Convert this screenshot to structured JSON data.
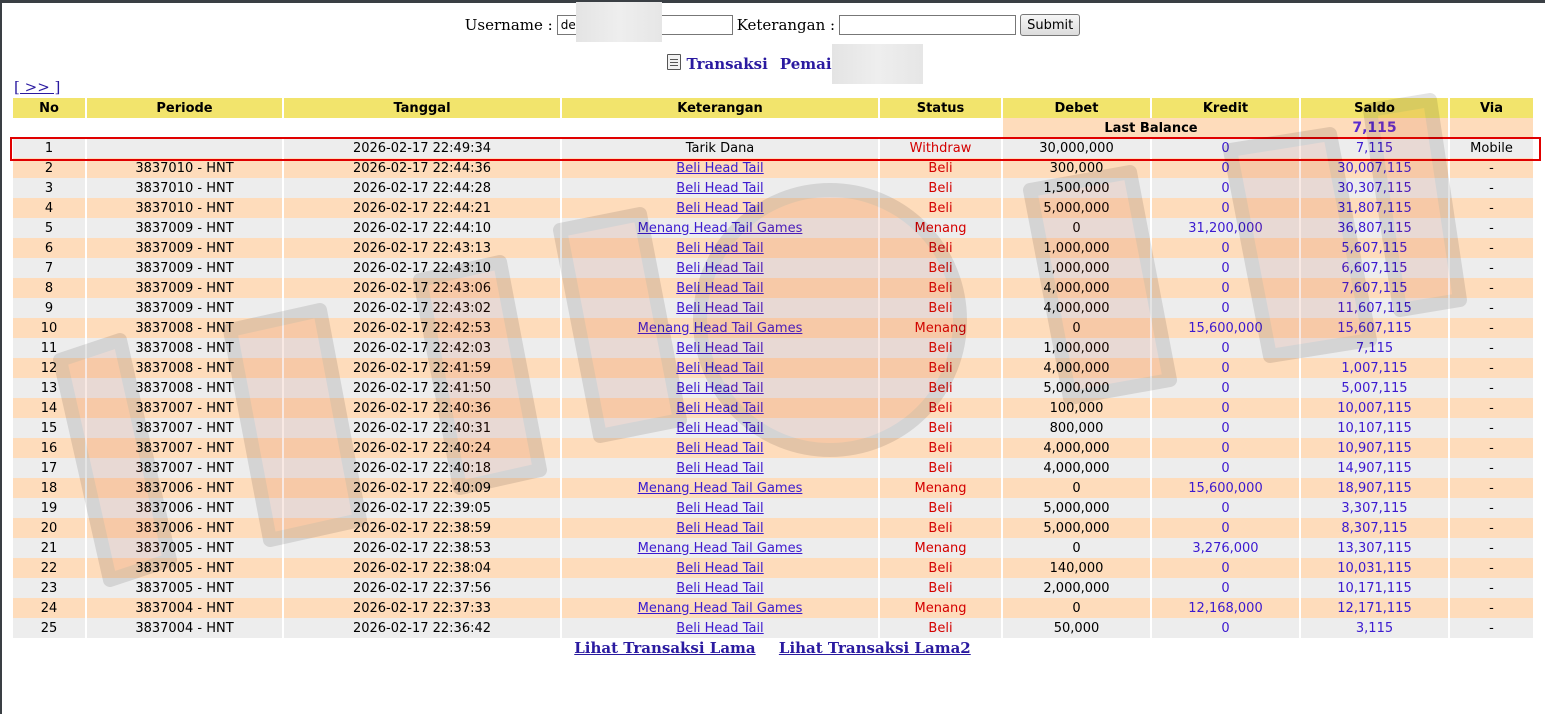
{
  "form": {
    "username_label": "Username :",
    "username_value": "de",
    "keterangan_label": "Keterangan :",
    "keterangan_value": "",
    "submit_label": "Submit"
  },
  "heading": {
    "title": "Transaksi",
    "player_label": "Pemain : de"
  },
  "nav": {
    "next_label": "[ >> ]"
  },
  "table": {
    "columns": [
      "No",
      "Periode",
      "Tanggal",
      "Keterangan",
      "Status",
      "Debet",
      "Kredit",
      "Saldo",
      "Via"
    ],
    "last_balance_label": "Last Balance",
    "last_balance_value": "7,115",
    "rows": [
      {
        "no": "1",
        "periode": "",
        "tanggal": "2026-02-17 22:49:34",
        "keterangan": "Tarik Dana",
        "status": "Withdraw",
        "debet": "30,000,000",
        "kredit": "0",
        "saldo": "7,115",
        "via": "Mobile"
      },
      {
        "no": "2",
        "periode": "3837010 - HNT",
        "tanggal": "2026-02-17 22:44:36",
        "keterangan": "Beli Head Tail",
        "status": "Beli",
        "debet": "300,000",
        "kredit": "0",
        "saldo": "30,007,115",
        "via": "-"
      },
      {
        "no": "3",
        "periode": "3837010 - HNT",
        "tanggal": "2026-02-17 22:44:28",
        "keterangan": "Beli Head Tail",
        "status": "Beli",
        "debet": "1,500,000",
        "kredit": "0",
        "saldo": "30,307,115",
        "via": "-"
      },
      {
        "no": "4",
        "periode": "3837010 - HNT",
        "tanggal": "2026-02-17 22:44:21",
        "keterangan": "Beli Head Tail",
        "status": "Beli",
        "debet": "5,000,000",
        "kredit": "0",
        "saldo": "31,807,115",
        "via": "-"
      },
      {
        "no": "5",
        "periode": "3837009 - HNT",
        "tanggal": "2026-02-17 22:44:10",
        "keterangan": "Menang Head Tail Games",
        "status": "Menang",
        "debet": "0",
        "kredit": "31,200,000",
        "saldo": "36,807,115",
        "via": "-"
      },
      {
        "no": "6",
        "periode": "3837009 - HNT",
        "tanggal": "2026-02-17 22:43:13",
        "keterangan": "Beli Head Tail",
        "status": "Beli",
        "debet": "1,000,000",
        "kredit": "0",
        "saldo": "5,607,115",
        "via": "-"
      },
      {
        "no": "7",
        "periode": "3837009 - HNT",
        "tanggal": "2026-02-17 22:43:10",
        "keterangan": "Beli Head Tail",
        "status": "Beli",
        "debet": "1,000,000",
        "kredit": "0",
        "saldo": "6,607,115",
        "via": "-"
      },
      {
        "no": "8",
        "periode": "3837009 - HNT",
        "tanggal": "2026-02-17 22:43:06",
        "keterangan": "Beli Head Tail",
        "status": "Beli",
        "debet": "4,000,000",
        "kredit": "0",
        "saldo": "7,607,115",
        "via": "-"
      },
      {
        "no": "9",
        "periode": "3837009 - HNT",
        "tanggal": "2026-02-17 22:43:02",
        "keterangan": "Beli Head Tail",
        "status": "Beli",
        "debet": "4,000,000",
        "kredit": "0",
        "saldo": "11,607,115",
        "via": "-"
      },
      {
        "no": "10",
        "periode": "3837008 - HNT",
        "tanggal": "2026-02-17 22:42:53",
        "keterangan": "Menang Head Tail Games",
        "status": "Menang",
        "debet": "0",
        "kredit": "15,600,000",
        "saldo": "15,607,115",
        "via": "-"
      },
      {
        "no": "11",
        "periode": "3837008 - HNT",
        "tanggal": "2026-02-17 22:42:03",
        "keterangan": "Beli Head Tail",
        "status": "Beli",
        "debet": "1,000,000",
        "kredit": "0",
        "saldo": "7,115",
        "via": "-"
      },
      {
        "no": "12",
        "periode": "3837008 - HNT",
        "tanggal": "2026-02-17 22:41:59",
        "keterangan": "Beli Head Tail",
        "status": "Beli",
        "debet": "4,000,000",
        "kredit": "0",
        "saldo": "1,007,115",
        "via": "-"
      },
      {
        "no": "13",
        "periode": "3837008 - HNT",
        "tanggal": "2026-02-17 22:41:50",
        "keterangan": "Beli Head Tail",
        "status": "Beli",
        "debet": "5,000,000",
        "kredit": "0",
        "saldo": "5,007,115",
        "via": "-"
      },
      {
        "no": "14",
        "periode": "3837007 - HNT",
        "tanggal": "2026-02-17 22:40:36",
        "keterangan": "Beli Head Tail",
        "status": "Beli",
        "debet": "100,000",
        "kredit": "0",
        "saldo": "10,007,115",
        "via": "-"
      },
      {
        "no": "15",
        "periode": "3837007 - HNT",
        "tanggal": "2026-02-17 22:40:31",
        "keterangan": "Beli Head Tail",
        "status": "Beli",
        "debet": "800,000",
        "kredit": "0",
        "saldo": "10,107,115",
        "via": "-"
      },
      {
        "no": "16",
        "periode": "3837007 - HNT",
        "tanggal": "2026-02-17 22:40:24",
        "keterangan": "Beli Head Tail",
        "status": "Beli",
        "debet": "4,000,000",
        "kredit": "0",
        "saldo": "10,907,115",
        "via": "-"
      },
      {
        "no": "17",
        "periode": "3837007 - HNT",
        "tanggal": "2026-02-17 22:40:18",
        "keterangan": "Beli Head Tail",
        "status": "Beli",
        "debet": "4,000,000",
        "kredit": "0",
        "saldo": "14,907,115",
        "via": "-"
      },
      {
        "no": "18",
        "periode": "3837006 - HNT",
        "tanggal": "2026-02-17 22:40:09",
        "keterangan": "Menang Head Tail Games",
        "status": "Menang",
        "debet": "0",
        "kredit": "15,600,000",
        "saldo": "18,907,115",
        "via": "-"
      },
      {
        "no": "19",
        "periode": "3837006 - HNT",
        "tanggal": "2026-02-17 22:39:05",
        "keterangan": "Beli Head Tail",
        "status": "Beli",
        "debet": "5,000,000",
        "kredit": "0",
        "saldo": "3,307,115",
        "via": "-"
      },
      {
        "no": "20",
        "periode": "3837006 - HNT",
        "tanggal": "2026-02-17 22:38:59",
        "keterangan": "Beli Head Tail",
        "status": "Beli",
        "debet": "5,000,000",
        "kredit": "0",
        "saldo": "8,307,115",
        "via": "-"
      },
      {
        "no": "21",
        "periode": "3837005 - HNT",
        "tanggal": "2026-02-17 22:38:53",
        "keterangan": "Menang Head Tail Games",
        "status": "Menang",
        "debet": "0",
        "kredit": "3,276,000",
        "saldo": "13,307,115",
        "via": "-"
      },
      {
        "no": "22",
        "periode": "3837005 - HNT",
        "tanggal": "2026-02-17 22:38:04",
        "keterangan": "Beli Head Tail",
        "status": "Beli",
        "debet": "140,000",
        "kredit": "0",
        "saldo": "10,031,115",
        "via": "-"
      },
      {
        "no": "23",
        "periode": "3837005 - HNT",
        "tanggal": "2026-02-17 22:37:56",
        "keterangan": "Beli Head Tail",
        "status": "Beli",
        "debet": "2,000,000",
        "kredit": "0",
        "saldo": "10,171,115",
        "via": "-"
      },
      {
        "no": "24",
        "periode": "3837004 - HNT",
        "tanggal": "2026-02-17 22:37:33",
        "keterangan": "Menang Head Tail Games",
        "status": "Menang",
        "debet": "0",
        "kredit": "12,168,000",
        "saldo": "12,171,115",
        "via": "-"
      },
      {
        "no": "25",
        "periode": "3837004 - HNT",
        "tanggal": "2026-02-17 22:36:42",
        "keterangan": "Beli Head Tail",
        "status": "Beli",
        "debet": "50,000",
        "kredit": "0",
        "saldo": "3,115",
        "via": "-"
      }
    ]
  },
  "footer": {
    "link1": "Lihat Transaksi Lama",
    "link2": "Lihat Transaksi Lama2"
  },
  "colors": {
    "header": "#f2e46c",
    "row_a": "#ededed",
    "row_b": "#fedcbb",
    "link": "#3b1ad0",
    "status": "#d40000",
    "highlight": "#e00000"
  },
  "icons": {
    "heading_icon": "document-icon"
  }
}
